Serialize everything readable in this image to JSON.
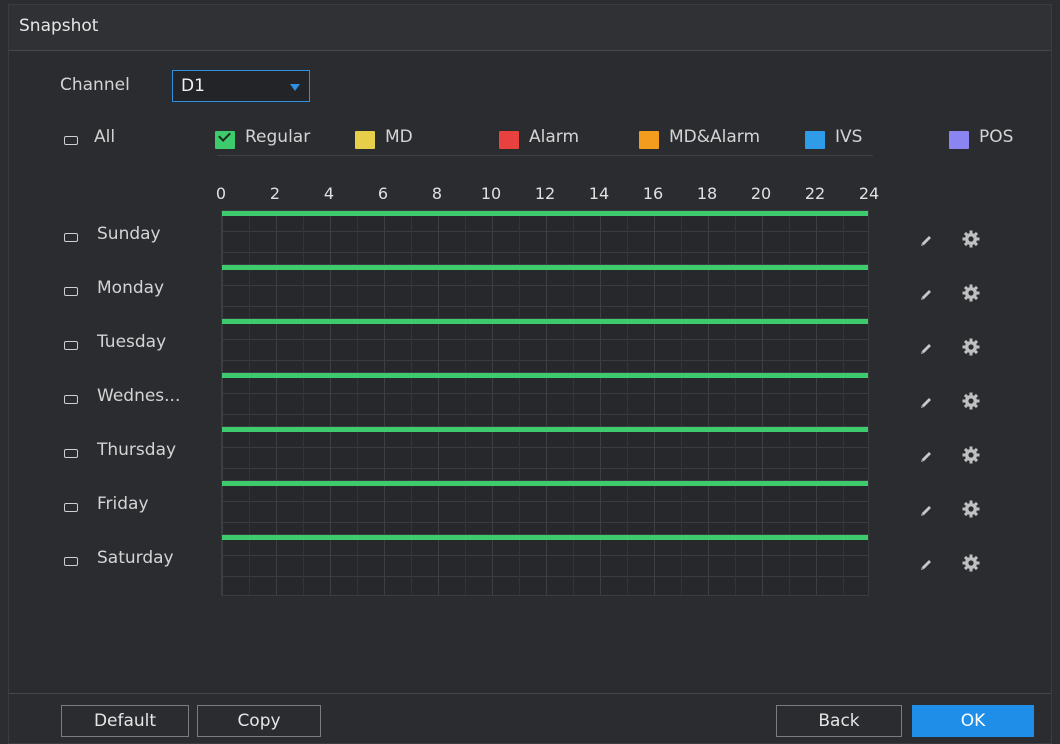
{
  "window": {
    "title": "Snapshot"
  },
  "channel": {
    "label": "Channel",
    "value": "D1"
  },
  "legend": {
    "all_label": "All",
    "items": [
      {
        "label": "Regular",
        "color": "#3ecb6d",
        "checked": true
      },
      {
        "label": "MD",
        "color": "#e8cf4a",
        "checked": false
      },
      {
        "label": "Alarm",
        "color": "#e94040",
        "checked": false
      },
      {
        "label": "MD&Alarm",
        "color": "#f39c1d",
        "checked": false
      },
      {
        "label": "IVS",
        "color": "#2f9ce8",
        "checked": false
      },
      {
        "label": "POS",
        "color": "#8a85f0",
        "checked": false
      }
    ]
  },
  "time_axis": {
    "ticks": [
      "0",
      "2",
      "4",
      "6",
      "8",
      "10",
      "12",
      "14",
      "16",
      "18",
      "20",
      "22",
      "24"
    ]
  },
  "days": [
    {
      "name": "Sunday",
      "coverage": 1.0
    },
    {
      "name": "Monday",
      "coverage": 1.0
    },
    {
      "name": "Tuesday",
      "coverage": 1.0
    },
    {
      "name": "Wednes...",
      "coverage": 1.0
    },
    {
      "name": "Thursday",
      "coverage": 1.0
    },
    {
      "name": "Friday",
      "coverage": 1.0
    },
    {
      "name": "Saturday",
      "coverage": 1.0
    }
  ],
  "row_icons": {
    "edit": "pencil-icon",
    "settings": "gear-icon"
  },
  "footer": {
    "default_label": "Default",
    "copy_label": "Copy",
    "back_label": "Back",
    "ok_label": "OK"
  }
}
